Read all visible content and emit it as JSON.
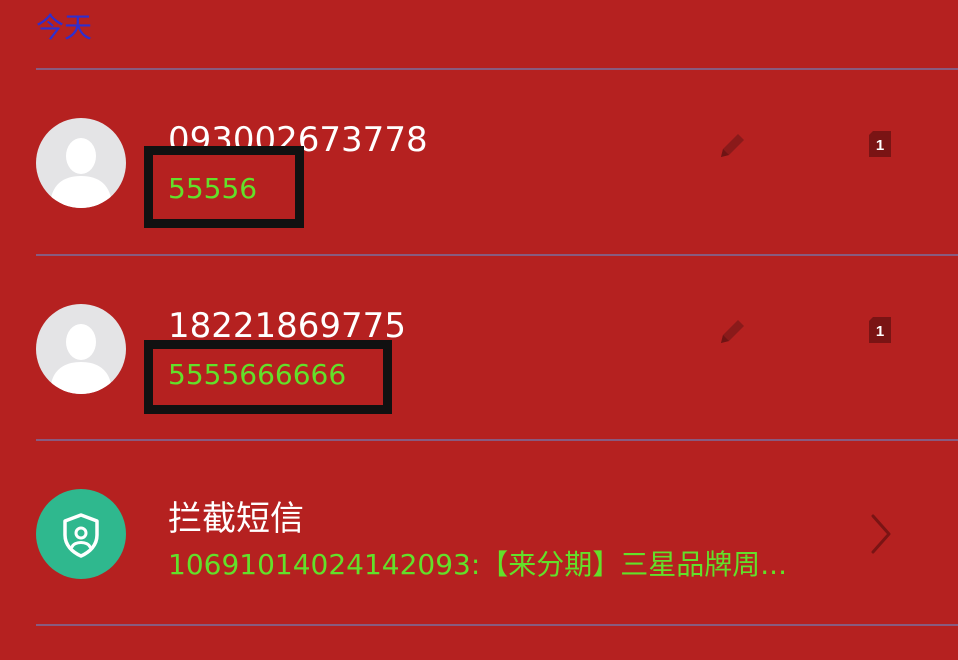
{
  "section": {
    "label": "今天"
  },
  "conversations": [
    {
      "name": "093002673778",
      "snippet": "55556",
      "sim": "1",
      "avatar_icon": "person-avatar-icon"
    },
    {
      "name": "18221869775",
      "snippet": "5555666666",
      "sim": "1",
      "avatar_icon": "person-avatar-icon"
    }
  ],
  "blocked": {
    "title": "拦截短信",
    "snippet": "10691014024142093:【来分期】三星品牌周...",
    "icon": "shield-user-icon",
    "chevron_icon": "chevron-right-icon"
  },
  "colors": {
    "background": "#b52120",
    "header_text": "#2e2fd0",
    "snippet_text": "#63e02a",
    "shield_bg": "#2fb88e"
  }
}
